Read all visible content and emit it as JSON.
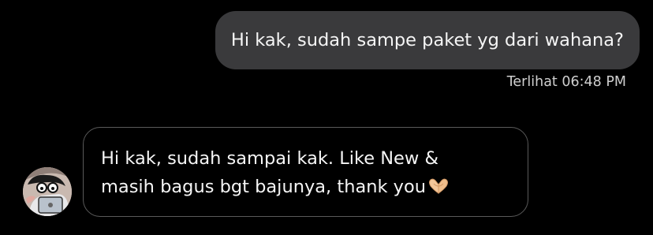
{
  "messages": {
    "outgoing": {
      "text": "Hi kak, sudah sampe paket yg dari wahana?",
      "status": "Terlihat 06:48 PM"
    },
    "incoming": {
      "line1": "Hi kak, sudah sampai kak. Like New &",
      "line2": "masih bagus bgt bajunya, thank you",
      "emoji": "heart-hands-icon",
      "avatar": "sender-avatar"
    }
  },
  "colors": {
    "background": "#000000",
    "outgoing_bubble": "#3a3a3c",
    "incoming_border": "#5a5a5a",
    "text": "#f5f5f5",
    "status_text": "#cfcfcf"
  }
}
